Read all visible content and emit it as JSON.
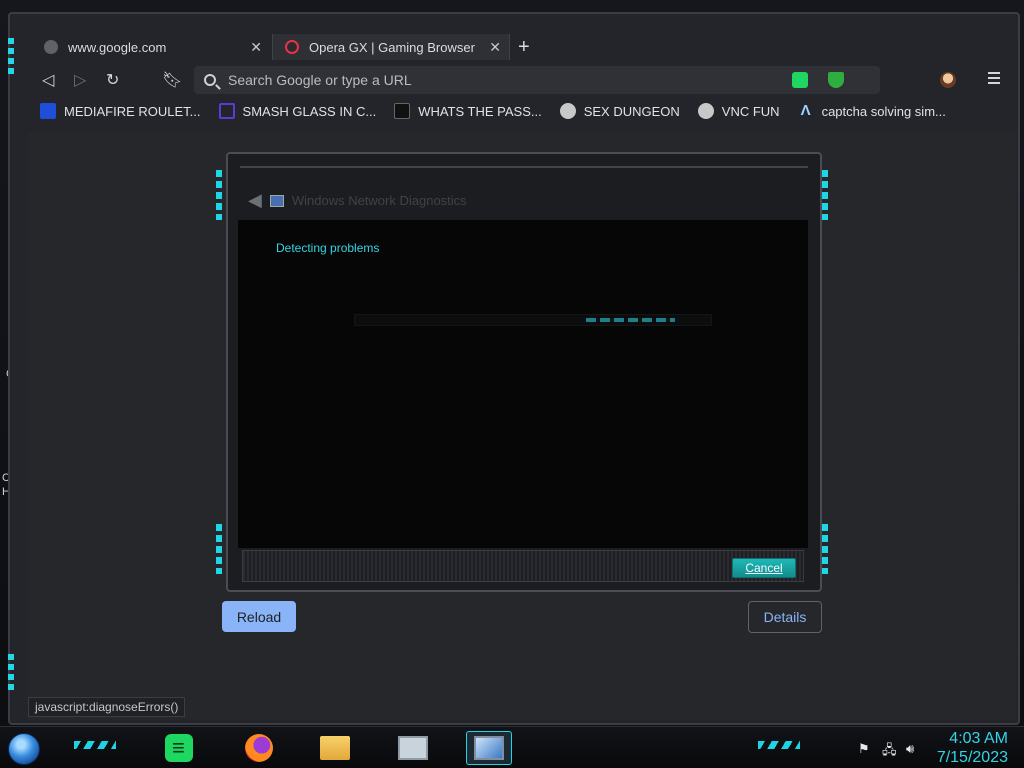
{
  "desktop": {
    "left_chars": [
      "C",
      "C",
      "H."
    ]
  },
  "tabs": [
    {
      "title": "www.google.com",
      "favicon": "globe-icon"
    },
    {
      "title": "Opera GX | Gaming Browser",
      "favicon": "opera-gx-icon"
    }
  ],
  "toolbar": {
    "omnibox_placeholder": "Search Google or type a URL",
    "icons": [
      "back-icon",
      "forward-icon",
      "reload-icon",
      "bookmark-icon",
      "search-icon",
      "spotify-extension-icon",
      "shield-extension-icon",
      "avatar",
      "menu-icon"
    ]
  },
  "bookmarks": [
    {
      "label": "MEDIAFIRE ROULET...",
      "icon": "mediafire-icon",
      "color": "#1f4fd8"
    },
    {
      "label": "SMASH GLASS IN C...",
      "icon": "visual-studio-icon",
      "color": "#5c3ad6"
    },
    {
      "label": "WHATS THE PASS...",
      "icon": "dark-site-icon",
      "color": "#111111"
    },
    {
      "label": "SEX DUNGEON",
      "icon": "bandit-icon",
      "color": "#c8c8c8"
    },
    {
      "label": "VNC FUN",
      "icon": "bandit-icon",
      "color": "#c8c8c8"
    },
    {
      "label": "captcha solving sim...",
      "icon": "a-logo-icon",
      "color": "#9ad0ff"
    }
  ],
  "dialog": {
    "title": "Windows Network Diagnostics",
    "status": "Detecting problems",
    "progress_level": 0.9,
    "cancel_label": "Cancel"
  },
  "page_buttons": {
    "reload_label": "Reload",
    "details_label": "Details"
  },
  "status_bar": {
    "text": "javascript:diagnoseErrors()"
  },
  "taskbar": {
    "items": [
      "spotify",
      "firefox",
      "file-explorer",
      "resource-monitor",
      "network-diagnostics"
    ],
    "clock_time": "4:03 AM",
    "clock_date": "7/15/2023"
  },
  "colors": {
    "accent": "#27d6e6",
    "reload_bg": "#8ab4f8",
    "cancel_bg": "#1fb8b6"
  }
}
